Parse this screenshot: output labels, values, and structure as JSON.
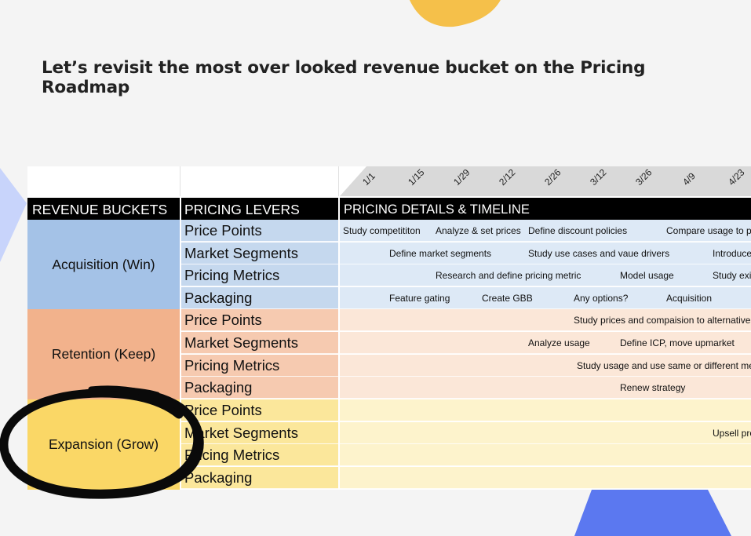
{
  "heading": "Let’s revisit the most over looked revenue bucket on the Pricing Roadmap",
  "headers": {
    "buckets": "REVENUE BUCKETS",
    "levers": "PRICING LEVERS",
    "details": "PRICING DETAILS & TIMELINE"
  },
  "dates": [
    "1/1",
    "1/15",
    "1/29",
    "2/12",
    "2/26",
    "3/12",
    "3/26",
    "4/9",
    "4/23"
  ],
  "buckets": [
    {
      "label": "Acquisition (Win)"
    },
    {
      "label": "Retention (Keep)"
    },
    {
      "label": "Expansion (Grow)"
    }
  ],
  "levers": [
    "Price Points",
    "Market Segments",
    "Pricing Metrics",
    "Packaging"
  ],
  "tasks": {
    "acq_price": [
      "Study competititon",
      "Analyze & set prices",
      "Define discount policies",
      "Compare usage to p"
    ],
    "acq_segments": [
      "Define market segments",
      "Study use cases and vaue drivers",
      "Introduce"
    ],
    "acq_metrics": [
      "Research and define pricing metric",
      "Model usage",
      "Study exi"
    ],
    "acq_packaging": [
      "Feature gating",
      "Create GBB",
      "Any options?",
      "Acquisition"
    ],
    "ret_price": [
      "Study prices and compaision to alternatives"
    ],
    "ret_segments": [
      "Analyze usage",
      "Define ICP, move upmarket"
    ],
    "ret_metrics": [
      "Study usage and use same or different me"
    ],
    "ret_packaging": [
      "Renew strategy"
    ],
    "exp_segments": [
      "Upsell pro"
    ]
  },
  "colors": {
    "acquisition": "#a4c2e7",
    "retention": "#f2b28c",
    "expansion": "#fad766",
    "deco_yellow": "#f5c04a",
    "deco_blue": "#5b78f0",
    "deco_lightblue": "#c8d4fb"
  }
}
